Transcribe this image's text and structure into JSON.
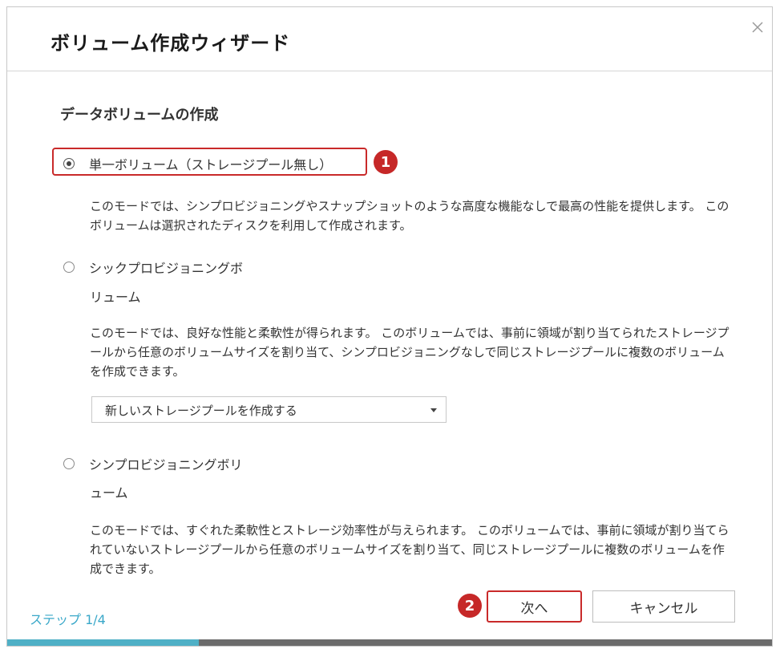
{
  "dialog": {
    "title": "ボリューム作成ウィザード"
  },
  "section_title": "データボリュームの作成",
  "options": [
    {
      "label": "単一ボリューム（ストレージプール無し）",
      "selected": true,
      "description": "このモードでは、シンプロビジョニングやスナップショットのような高度な機能なしで最高の性能を提供します。 このボリュームは選択されたディスクを利用して作成されます。"
    },
    {
      "label": "シックプロビジョニングボ",
      "label_cont": "リューム",
      "selected": false,
      "description": "このモードでは、良好な性能と柔軟性が得られます。 このボリュームでは、事前に領域が割り当てられたストレージプールから任意のボリュームサイズを割り当て、シンプロビジョニングなしで同じストレージプールに複数のボリュームを作成できます。"
    },
    {
      "label": "シンプロビジョニングボリ",
      "label_cont": "ューム",
      "selected": false,
      "description": "このモードでは、すぐれた柔軟性とストレージ効率性が与えられます。 このボリュームでは、事前に領域が割り当てられていないストレージプールから任意のボリュームサイズを割り当て、同じストレージプールに複数のボリュームを作成できます。"
    }
  ],
  "pool_select": {
    "value": "新しいストレージプールを作成する"
  },
  "footer": {
    "step": "ステップ 1/4",
    "next_label": "次へ",
    "cancel_label": "キャンセル",
    "progress": 0.25
  },
  "annotations": {
    "marker1": "1",
    "marker2": "2"
  },
  "colors": {
    "accent": "#4fb0c6",
    "highlight": "#c92a2a",
    "marker": "#c62828"
  },
  "icons": {
    "close": "close-icon",
    "dropdown": "chevron-down-icon"
  }
}
